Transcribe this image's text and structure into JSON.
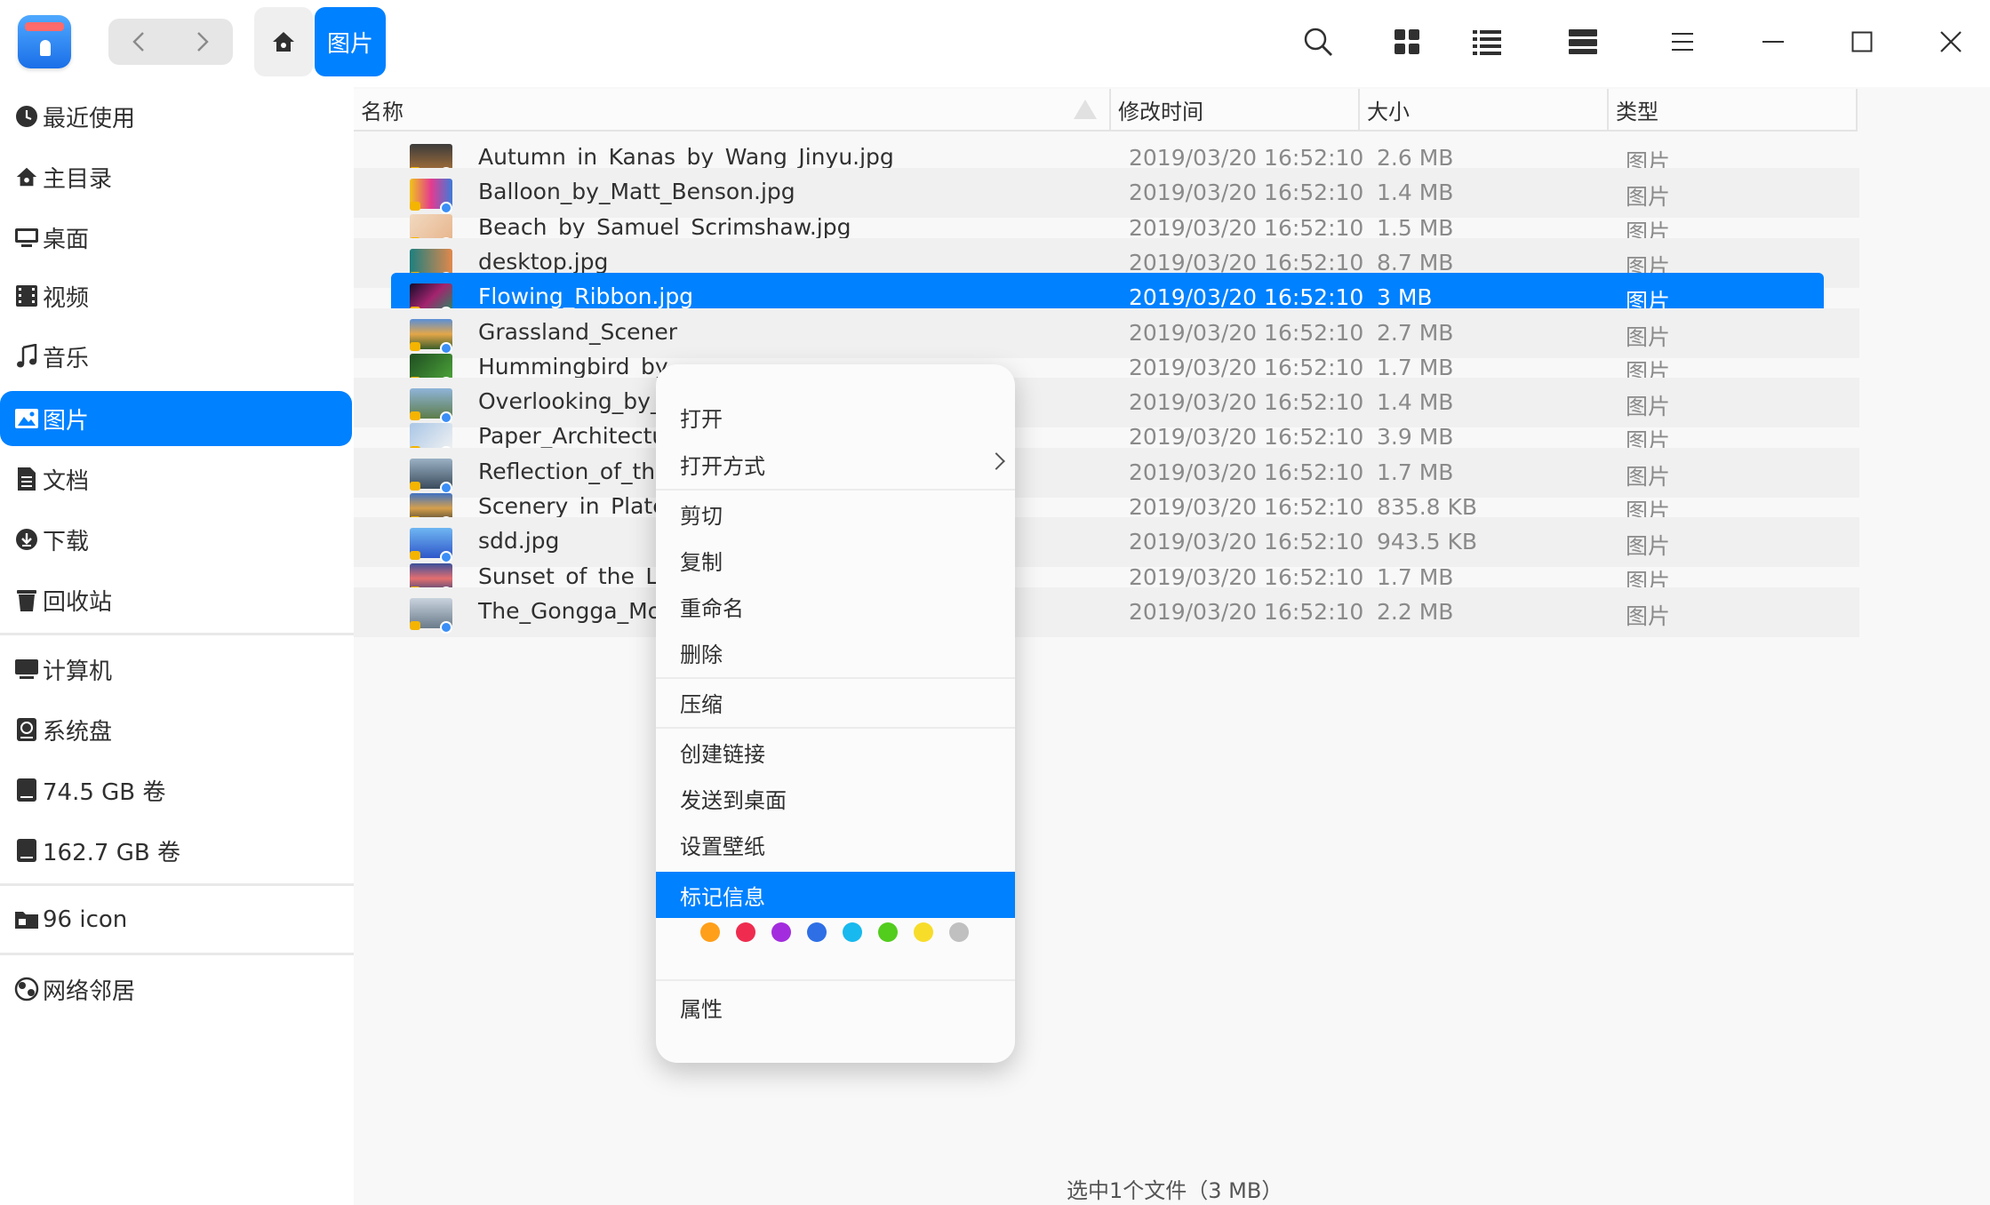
{
  "colors": {
    "accent": "#0081ff"
  },
  "titlebar": {
    "breadcrumb_current": "图片",
    "icons": [
      "back-icon",
      "forward-icon",
      "home-icon",
      "search-icon",
      "icon-view-icon",
      "list-view-icon",
      "detail-view-icon",
      "menu-icon",
      "minimize-icon",
      "maximize-icon",
      "close-icon"
    ]
  },
  "sidebar": {
    "items": [
      {
        "label": "最近使用",
        "icon": "clock-icon"
      },
      {
        "label": "主目录",
        "icon": "home-icon"
      },
      {
        "label": "桌面",
        "icon": "desktop-icon"
      },
      {
        "label": "视频",
        "icon": "video-icon"
      },
      {
        "label": "音乐",
        "icon": "music-icon"
      },
      {
        "label": "图片",
        "icon": "picture-icon"
      },
      {
        "label": "文档",
        "icon": "document-icon"
      },
      {
        "label": "下载",
        "icon": "download-icon"
      },
      {
        "label": "回收站",
        "icon": "trash-icon"
      },
      {
        "label": "计算机",
        "icon": "computer-icon"
      },
      {
        "label": "系统盘",
        "icon": "disk-icon"
      },
      {
        "label": "74.5 GB 卷",
        "icon": "disk-icon"
      },
      {
        "label": "162.7 GB 卷",
        "icon": "disk-icon"
      },
      {
        "label": "96 icon",
        "icon": "folder-icon"
      },
      {
        "label": "网络邻居",
        "icon": "network-icon"
      }
    ],
    "active": "图片"
  },
  "table": {
    "columns": [
      "名称",
      "修改时间",
      "大小",
      "类型"
    ],
    "rows": [
      {
        "name": "Autumn_in_Kanas_by_Wang_Jinyu.jpg",
        "mtime": "2019/03/20 16:52:10",
        "size": "2.6 MB",
        "type": "图片"
      },
      {
        "name": "Balloon_by_Matt_Benson.jpg",
        "mtime": "2019/03/20 16:52:10",
        "size": "1.4 MB",
        "type": "图片"
      },
      {
        "name": "Beach_by_Samuel_Scrimshaw.jpg",
        "mtime": "2019/03/20 16:52:10",
        "size": "1.5 MB",
        "type": "图片"
      },
      {
        "name": "desktop.jpg",
        "mtime": "2019/03/20 16:52:10",
        "size": "8.7 MB",
        "type": "图片"
      },
      {
        "name": "Flowing_Ribbon.jpg",
        "mtime": "2019/03/20 16:52:10",
        "size": "3 MB",
        "type": "图片"
      },
      {
        "name": "Grassland_Scener",
        "mtime": "2019/03/20 16:52:10",
        "size": "2.7 MB",
        "type": "图片"
      },
      {
        "name": "Hummingbird_by_",
        "mtime": "2019/03/20 16:52:10",
        "size": "1.7 MB",
        "type": "图片"
      },
      {
        "name": "Overlooking_by_L",
        "mtime": "2019/03/20 16:52:10",
        "size": "1.4 MB",
        "type": "图片"
      },
      {
        "name": "Paper_Architectur",
        "mtime": "2019/03/20 16:52:10",
        "size": "3.9 MB",
        "type": "图片"
      },
      {
        "name": "Reflection_of_the",
        "mtime": "2019/03/20 16:52:10",
        "size": "1.7 MB",
        "type": "图片"
      },
      {
        "name": "Scenery_in_Plate",
        "mtime": "2019/03/20 16:52:10",
        "size": "835.8 KB",
        "type": "图片"
      },
      {
        "name": "sdd.jpg",
        "mtime": "2019/03/20 16:52:10",
        "size": "943.5 KB",
        "type": "图片"
      },
      {
        "name": "Sunset_of_the_La",
        "mtime": "2019/03/20 16:52:10",
        "size": "1.7 MB",
        "type": "图片"
      },
      {
        "name": "The_Gongga_Mou",
        "mtime": "2019/03/20 16:52:10",
        "size": "2.2 MB",
        "type": "图片"
      }
    ],
    "selected": "Flowing_Ribbon.jpg"
  },
  "context_menu": {
    "items": [
      "打开",
      "打开方式",
      "剪切",
      "复制",
      "重命名",
      "删除",
      "压缩",
      "创建链接",
      "发送到桌面",
      "设置壁纸",
      "标记信息",
      "属性"
    ],
    "highlighted": "标记信息",
    "tag_colors": [
      "#ff9f1a",
      "#ef2c4f",
      "#a32dde",
      "#2e6fe6",
      "#17b9ee",
      "#52cc1d",
      "#f7dd2a",
      "#c0c0c0"
    ]
  },
  "status": "选中1个文件（3 MB）"
}
